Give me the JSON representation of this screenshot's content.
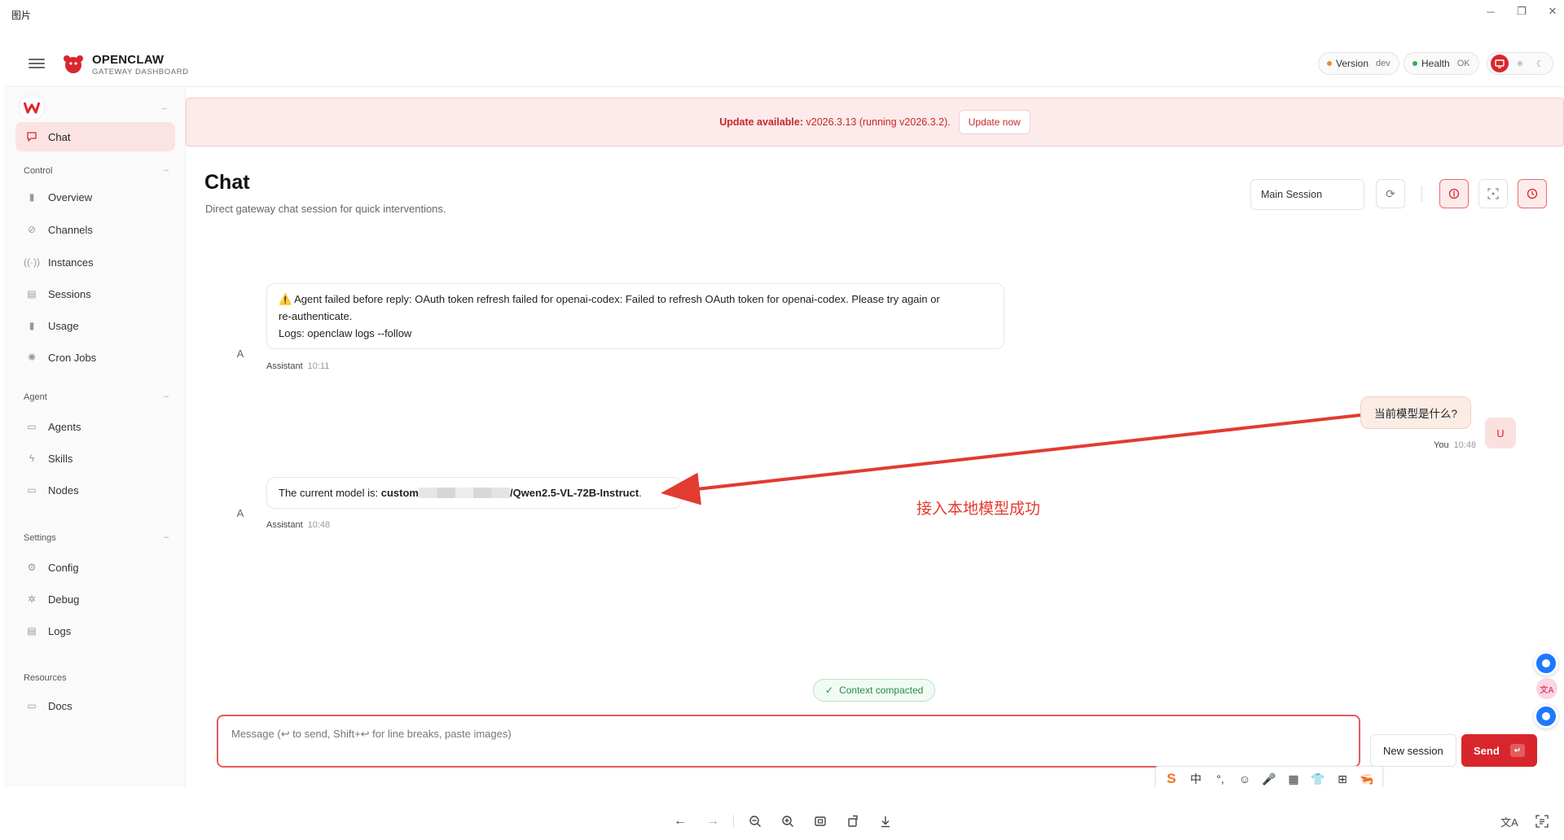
{
  "viewer": {
    "title": "图片",
    "controls": {
      "minimize": "─",
      "restore": "❐",
      "close": "✕"
    },
    "toolbar_icons": [
      "arrow-left-icon",
      "arrow-right-icon",
      "zoom-out-icon",
      "zoom-in-icon",
      "fit-icon",
      "rotate-icon",
      "download-icon"
    ],
    "right_icons": [
      "translate-icon",
      "ocr-icon"
    ]
  },
  "header": {
    "brand_name": "OPENCLAW",
    "brand_sub": "GATEWAY DASHBOARD",
    "version_label": "Version",
    "version_value": "dev",
    "health_label": "Health",
    "health_value": "OK",
    "colors": {
      "accent": "#d9262d",
      "version_dot": "#f08c2b",
      "health_dot": "#2fb35a"
    }
  },
  "sidebar": {
    "active": "Chat",
    "sections": [
      {
        "label": "Control",
        "toggle": "–",
        "items": [
          "Overview",
          "Channels",
          "Instances",
          "Sessions",
          "Usage",
          "Cron Jobs"
        ]
      },
      {
        "label": "Agent",
        "toggle": "–",
        "items": [
          "Agents",
          "Skills",
          "Nodes"
        ]
      },
      {
        "label": "Settings",
        "toggle": "–",
        "items": [
          "Config",
          "Debug",
          "Logs"
        ]
      },
      {
        "label": "Resources",
        "toggle": "",
        "items": [
          "Docs"
        ]
      }
    ]
  },
  "banner": {
    "label": "Update available:",
    "text": "v2026.3.13 (running v2026.3.2).",
    "button": "Update now"
  },
  "page": {
    "title": "Chat",
    "subtitle": "Direct gateway chat session for quick interventions.",
    "session_select": "Main Session"
  },
  "messages": [
    {
      "role": "assistant",
      "avatar": "A",
      "line1": "⚠️ Agent failed before reply: OAuth token refresh failed for openai-codex: Failed to refresh OAuth token for openai-codex. Please try again or",
      "line2": "re-authenticate.",
      "line3": "Logs: openclaw logs --follow",
      "sender": "Assistant",
      "time": "10:11"
    },
    {
      "role": "user",
      "avatar": "U",
      "text": "当前模型是什么?",
      "sender": "You",
      "time": "10:48"
    },
    {
      "role": "assistant",
      "avatar": "A",
      "prefix": "The current model is: ",
      "model_start": "custom",
      "model_end": "/Qwen2.5-VL-72B-Instruct",
      "suffix": ".",
      "sender": "Assistant",
      "time": "10:48"
    }
  ],
  "annotation": {
    "text": "接入本地模型成功",
    "color": "#e23b30"
  },
  "composer": {
    "context_pill": "Context compacted",
    "placeholder": "Message (↩ to send, Shift+↩ for line breaks, paste images)",
    "new_session": "New session",
    "send": "Send"
  },
  "ime": {
    "items": [
      "S",
      "中",
      "°,",
      "☺",
      "🎤",
      "▦",
      "👕",
      "⊞",
      "🦐"
    ]
  }
}
